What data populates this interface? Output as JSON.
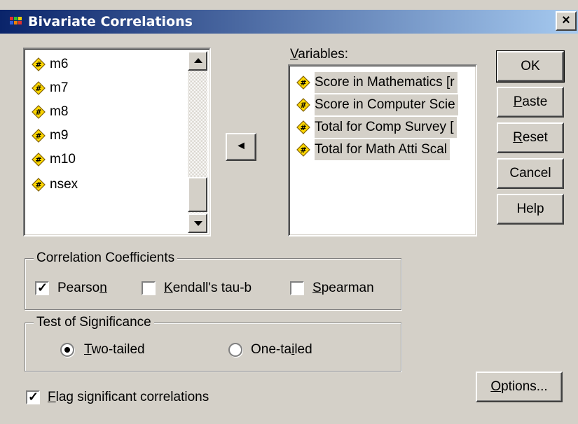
{
  "window": {
    "title": "Bivariate Correlations",
    "close_glyph": "×"
  },
  "source_list": {
    "items": [
      "m6",
      "m7",
      "m8",
      "m9",
      "m10",
      "nsex"
    ]
  },
  "move_button": {
    "glyph": "◄"
  },
  "variables": {
    "label_first": "V",
    "label_rest": "ariables:",
    "items": [
      "Score in Mathematics [r",
      "Score in Computer Scie",
      "Total for Comp Survey [",
      "Total for Math Atti Scal"
    ]
  },
  "buttons": {
    "ok": "OK",
    "paste_u": "P",
    "paste_rest": "aste",
    "reset_u": "R",
    "reset_rest": "eset",
    "cancel": "Cancel",
    "help": "Help",
    "options_u": "O",
    "options_rest": "ptions..."
  },
  "correlation": {
    "title": "Correlation Coefficients",
    "pearson_a": "Pearso",
    "pearson_u": "n",
    "pearson_checked": true,
    "kendall_u": "K",
    "kendall_rest": "endall's tau-b",
    "kendall_checked": false,
    "spearman_u": "S",
    "spearman_rest": "pearman",
    "spearman_checked": false
  },
  "significance": {
    "title": "Test of Significance",
    "two_u": "T",
    "two_rest": "wo-tailed",
    "two_selected": true,
    "one_a": "One-ta",
    "one_u": "i",
    "one_rest": "led",
    "one_selected": false
  },
  "flag": {
    "u": "F",
    "rest": "lag significant correlations",
    "checked": true
  },
  "colors": {
    "face": "#d4d0c8",
    "title_start": "#0a246a",
    "title_end": "#a6caf0",
    "icon_fill": "#ffd800"
  }
}
